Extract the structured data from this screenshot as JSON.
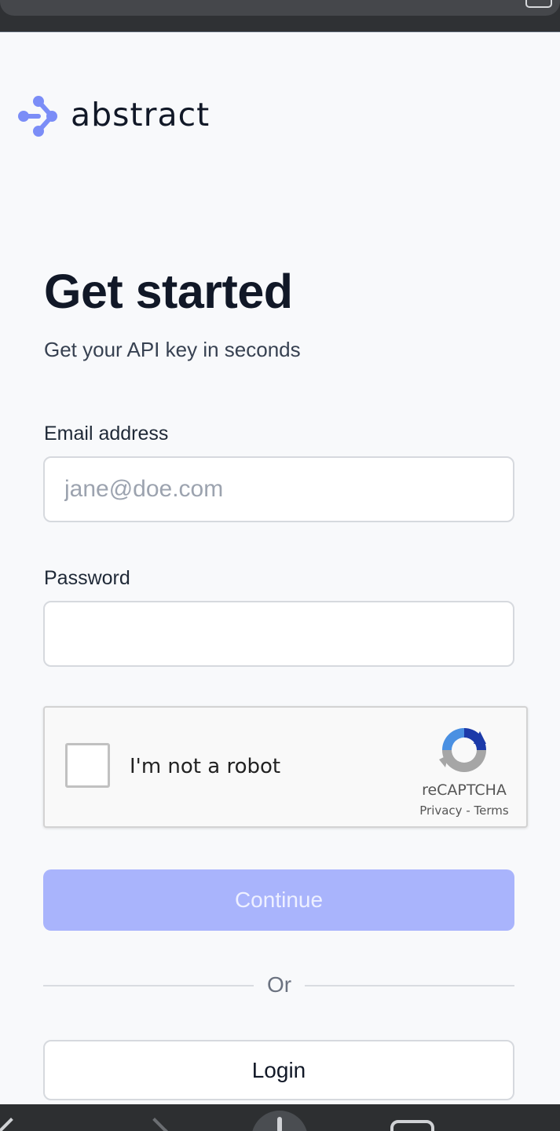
{
  "brand": {
    "name": "abstract",
    "accent_color": "#7b8df7"
  },
  "page": {
    "title": "Get started",
    "subtitle": "Get your API key in seconds"
  },
  "form": {
    "email_label": "Email address",
    "email_placeholder": "jane@doe.com",
    "email_value": "",
    "password_label": "Password",
    "password_value": ""
  },
  "captcha": {
    "label": "I'm not a robot",
    "checked": false,
    "brand": "reCAPTCHA",
    "privacy": "Privacy",
    "separator": "-",
    "terms": "Terms"
  },
  "actions": {
    "continue_label": "Continue",
    "continue_color": "#a9b4fc",
    "divider_text": "Or",
    "login_label": "Login"
  },
  "browser": {
    "nav_icons": [
      "back-icon",
      "forward-icon",
      "share-icon",
      "tabs-icon"
    ]
  }
}
